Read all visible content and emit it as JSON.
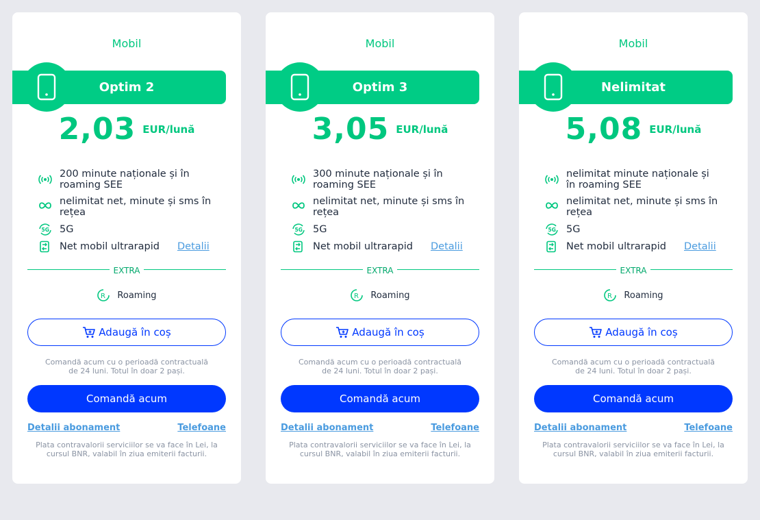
{
  "plans": [
    {
      "category": "Mobil",
      "name": "Optim 2",
      "price": "2,03",
      "unit": "EUR/lună",
      "features": [
        {
          "icon": "signal-icon",
          "text": "200 minute naționale și în roaming SEE"
        },
        {
          "icon": "infinity-icon",
          "text": "nelimitat net, minute și sms în rețea"
        },
        {
          "icon": "5g-icon",
          "text": "5G"
        },
        {
          "icon": "data-transfer-icon",
          "text": "Net mobil ultrarapid",
          "link": "Detalii"
        }
      ],
      "extra_label": "EXTRA",
      "extra_item": "Roaming",
      "cart_label": "Adaugă în coș",
      "contract_note": "Comandă acum cu o perioadă contractuală de 24 luni. Totul în doar 2 pași.",
      "order_label": "Comandă acum",
      "details_link": "Detalii abonament",
      "phones_link": "Telefoane",
      "payment_note": "Plata contravalorii serviciilor se va face în Lei, la cursul BNR, valabil în ziua emiterii facturii."
    },
    {
      "category": "Mobil",
      "name": "Optim 3",
      "price": "3,05",
      "unit": "EUR/lună",
      "features": [
        {
          "icon": "signal-icon",
          "text": "300 minute naționale și în roaming SEE"
        },
        {
          "icon": "infinity-icon",
          "text": "nelimitat net, minute și sms în rețea"
        },
        {
          "icon": "5g-icon",
          "text": "5G"
        },
        {
          "icon": "data-transfer-icon",
          "text": "Net mobil ultrarapid",
          "link": "Detalii"
        }
      ],
      "extra_label": "EXTRA",
      "extra_item": "Roaming",
      "cart_label": "Adaugă în coș",
      "contract_note": "Comandă acum cu o perioadă contractuală de 24 luni. Totul în doar 2 pași.",
      "order_label": "Comandă acum",
      "details_link": "Detalii abonament",
      "phones_link": "Telefoane",
      "payment_note": "Plata contravalorii serviciilor se va face în Lei, la cursul BNR, valabil în ziua emiterii facturii."
    },
    {
      "category": "Mobil",
      "name": "Nelimitat",
      "price": "5,08",
      "unit": "EUR/lună",
      "features": [
        {
          "icon": "signal-icon",
          "text": "nelimitat minute naționale și în roaming SEE"
        },
        {
          "icon": "infinity-icon",
          "text": "nelimitat net, minute și sms în rețea"
        },
        {
          "icon": "5g-icon",
          "text": "5G"
        },
        {
          "icon": "data-transfer-icon",
          "text": "Net mobil ultrarapid",
          "link": "Detalii"
        }
      ],
      "extra_label": "EXTRA",
      "extra_item": "Roaming",
      "cart_label": "Adaugă în coș",
      "contract_note": "Comandă acum cu o perioadă contractuală de 24 luni. Totul în doar 2 pași.",
      "order_label": "Comandă acum",
      "details_link": "Detalii abonament",
      "phones_link": "Telefoane",
      "payment_note": "Plata contravalorii serviciilor se va face în Lei, la cursul BNR, valabil în ziua emiterii facturii."
    }
  ],
  "colors": {
    "brand_green": "#00cc85",
    "accent_blue": "#0038ff",
    "link_blue": "#4a9bdf",
    "page_background": "#e8e9ee"
  }
}
